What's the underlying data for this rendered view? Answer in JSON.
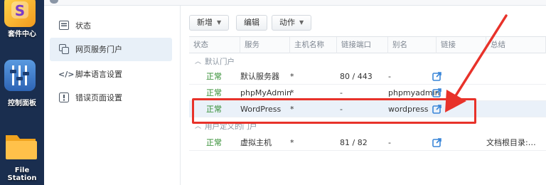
{
  "desktop": {
    "apps": [
      {
        "label": "套件中心",
        "icon": "package-center-icon",
        "color": "#f2b733"
      },
      {
        "label": "控制面板",
        "icon": "control-panel-icon",
        "color": "#3a79c9"
      },
      {
        "label": "File Station",
        "icon": "folder-icon",
        "color": "#f5a623"
      }
    ]
  },
  "sidebar": {
    "items": [
      {
        "label": "状态",
        "icon": "status-icon"
      },
      {
        "label": "网页服务门户",
        "icon": "web-portal-icon",
        "active": true
      },
      {
        "label": "脚本语言设置",
        "icon": "code-icon"
      },
      {
        "label": "错误页面设置",
        "icon": "error-page-icon"
      }
    ]
  },
  "toolbar": {
    "create_label": "新增",
    "edit_label": "编辑",
    "action_label": "动作"
  },
  "table": {
    "columns": [
      "状态",
      "服务",
      "主机名称",
      "链接端口",
      "别名",
      "链接",
      "总结"
    ],
    "groups": [
      {
        "label": "默认门户",
        "rows": [
          {
            "status": "正常",
            "service": "默认服务器",
            "hostname": "*",
            "port": "80 / 443",
            "alias": "-",
            "summary": ""
          },
          {
            "status": "正常",
            "service": "phpMyAdmin",
            "hostname": "*",
            "port": "-",
            "alias": "phpmyadmin",
            "summary": ""
          },
          {
            "status": "正常",
            "service": "WordPress",
            "hostname": "*",
            "port": "-",
            "alias": "wordpress",
            "summary": "",
            "selected": true
          }
        ]
      },
      {
        "label": "用户定义的门户",
        "rows": [
          {
            "status": "正常",
            "service": "虚拟主机",
            "hostname": "*",
            "port": "81 / 82",
            "alias": "-",
            "summary": "文档根目录:…"
          }
        ]
      }
    ]
  },
  "colors": {
    "accent": "#3a86d8",
    "status_ok": "#2e8b2e",
    "annotation": "#e8322a"
  }
}
